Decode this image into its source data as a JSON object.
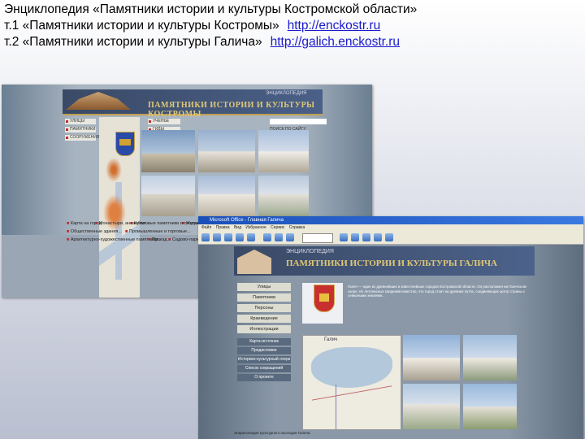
{
  "header": {
    "line1": "Энциклопедия «Памятники истории и культуры  Костромской области»",
    "line2_text": "т.1  «Памятники истории и культуры  Костромы»",
    "line2_url": "http://enckostr.ru",
    "line3_text": "т.2 «Памятники истории и культуры  Галича»",
    "line3_url": "http://galich.enckostr.ru"
  },
  "shot1": {
    "encyclopedia_label": "ЭНЦИКЛОПЕДИЯ",
    "title": "ПАМЯТНИКИ ИСТОРИИ И КУЛЬТУРЫ  КОСТРОМЫ",
    "nav": [
      "УЛИЦЫ",
      "ПАМЯТНИКИ",
      "СООРУЖЕНИЯ"
    ],
    "right_nav": [
      "УЧЕНЬЕ",
      "ГИДЫ"
    ],
    "search_hint": "ПОИСК ПО САЙТУ",
    "captions": [
      "Карта на город",
      "Монастыри, ансамбли...",
      "Культовые памятники и сооружения",
      "Жилые дома...",
      "Общественные здания...",
      "Промышленные и торговые...",
      "Архитектурно-художественные памятники...",
      "Проезд...",
      "Садово-парковые..."
    ]
  },
  "shot2": {
    "window_title": "Microsoft Office - Главная Галича",
    "menu": [
      "Файл",
      "Правка",
      "Вид",
      "Избранное",
      "Сервис",
      "Справка"
    ],
    "encyclopedia_label": "ЭНЦИКЛОПЕДИЯ",
    "title": "ПАМЯТНИКИ ИСТОРИИ И КУЛЬТУРЫ ГАЛИЧА",
    "nav": [
      "Улицы",
      "Памятники",
      "Персоны",
      "Краеведение",
      "Иллюстрации"
    ],
    "links": [
      "Карта-источник",
      "Предисловие",
      "Историко-культурный очерк",
      "Список сокращений",
      "О проекте"
    ],
    "intro": "Галич — один из древнейших и известнейших городов Костромской области. Он расположен на Галичском озере. Из летописных сведений известно, что город стоит на древних путях, соединяющих центр страны с северными землями...",
    "map_title": "Галич",
    "footer": "Энциклопедия культурного наследия Галича"
  }
}
